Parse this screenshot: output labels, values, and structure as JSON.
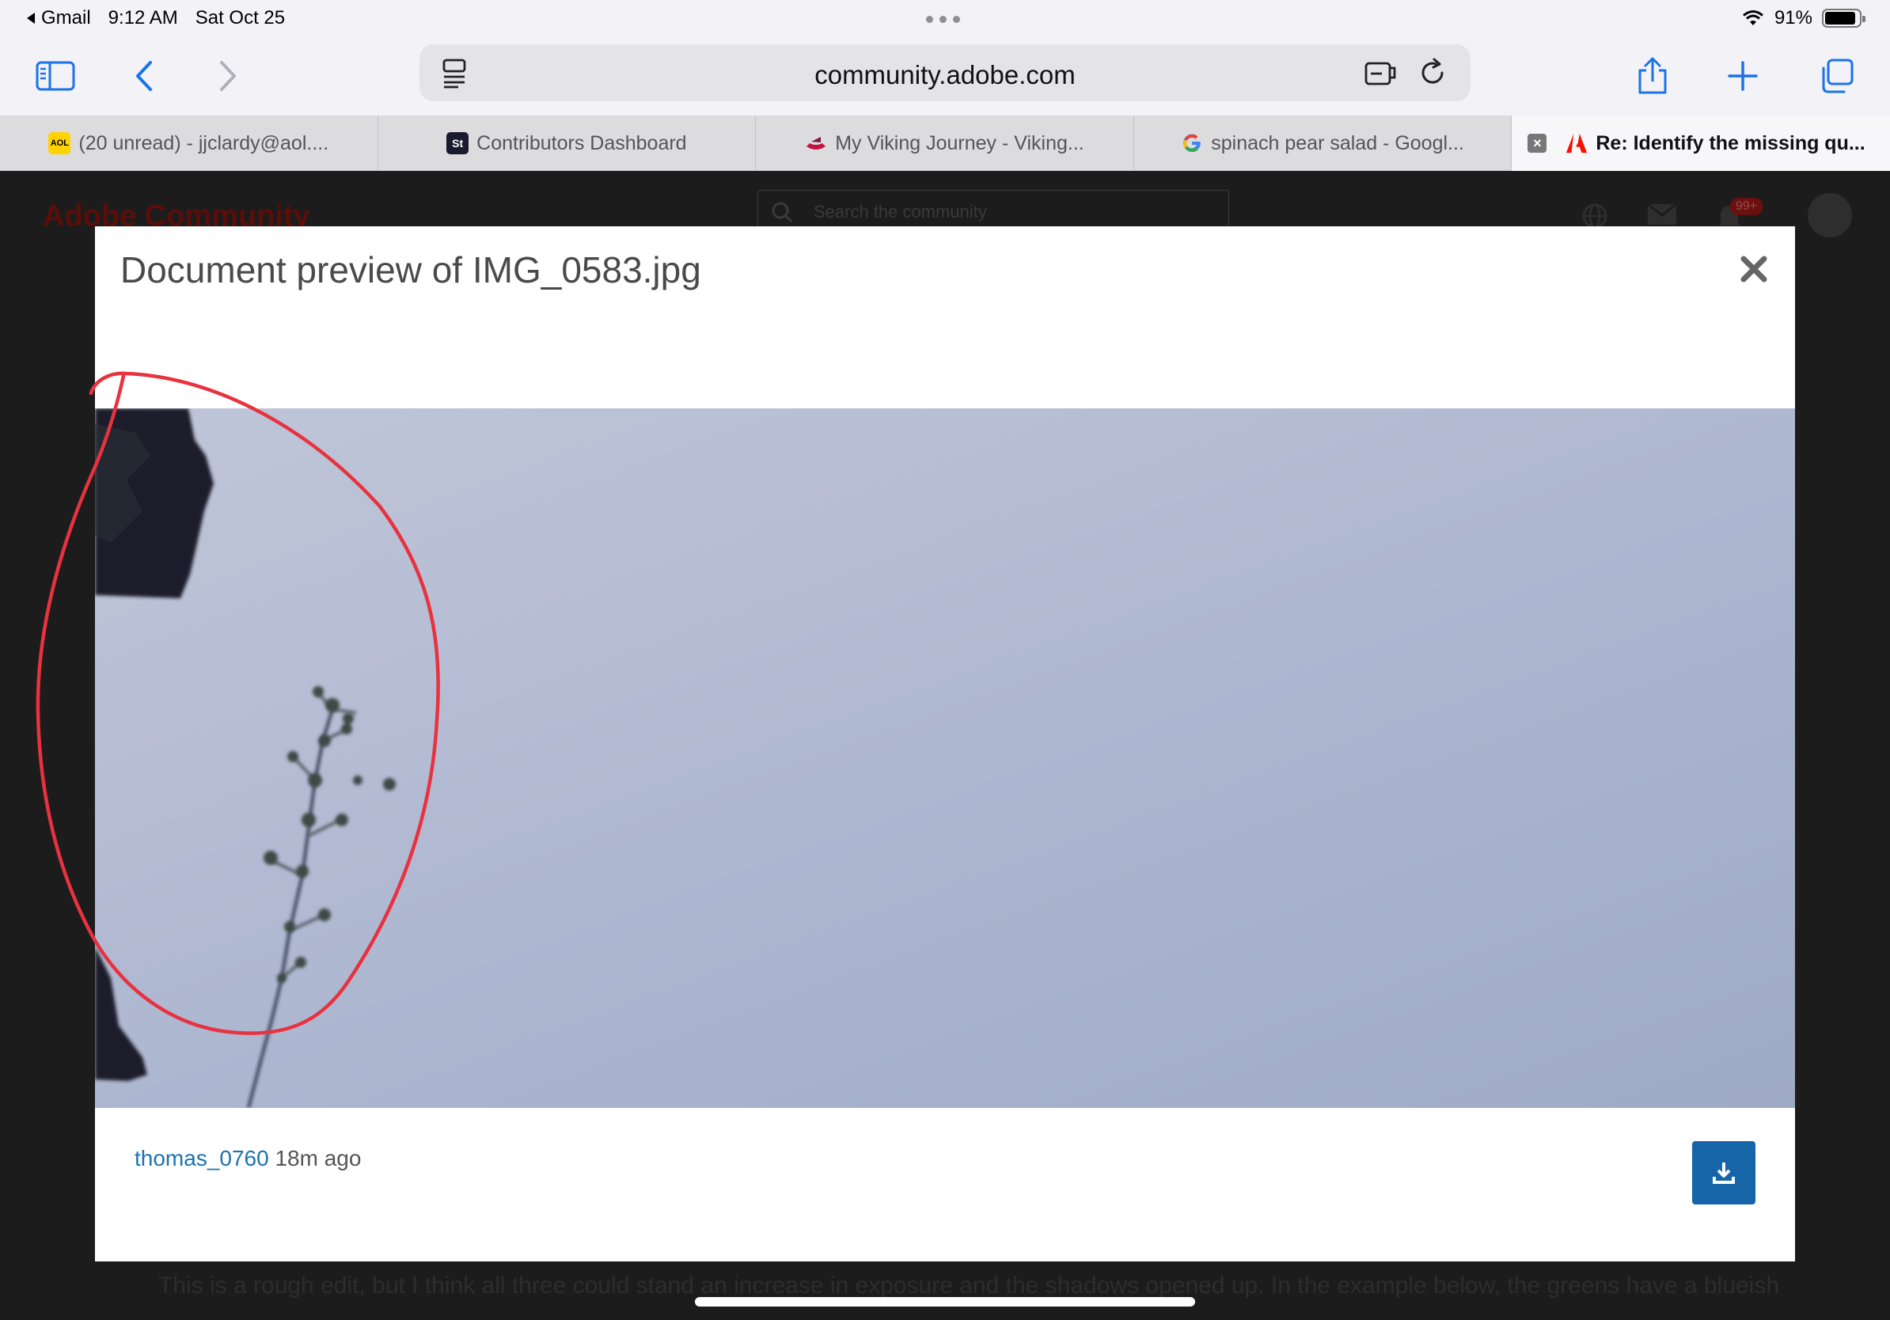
{
  "status_bar": {
    "back_app": "Gmail",
    "time": "9:12 AM",
    "date": "Sat Oct 25",
    "battery": "91%",
    "battery_level": 0.91
  },
  "toolbar": {
    "url": "community.adobe.com"
  },
  "tabs": [
    {
      "title": "(20 unread) - jjclardy@aol....",
      "favicon": "AOL",
      "favicon_color": "#ffd200"
    },
    {
      "title": "Contributors Dashboard",
      "favicon": "St",
      "favicon_color": "#1a1a2e"
    },
    {
      "title": "My Viking Journey - Viking...",
      "favicon": "viking-ship-icon",
      "favicon_color": "#c4123f"
    },
    {
      "title": "spinach pear salad - Googl...",
      "favicon": "G",
      "favicon_color": "#4285f4"
    },
    {
      "title": "Re: Identify the missing qu...",
      "favicon": "adobe-icon",
      "favicon_color": "#fa0f00",
      "active": true
    }
  ],
  "page": {
    "brand": "Adobe Community",
    "search_placeholder": "Search the community",
    "notification_count": "99+",
    "body_text": "This is a rough edit, but I think all three could stand an increase in exposure and the shadows opened up. In the example below, the greens have a blueish"
  },
  "modal": {
    "title": "Document preview of IMG_0583.jpg",
    "author": "thomas_0760",
    "time_ago": "18m ago"
  },
  "colors": {
    "accent": "#1565a8",
    "annotation": "#e8323f",
    "link": "#1c72b0"
  }
}
